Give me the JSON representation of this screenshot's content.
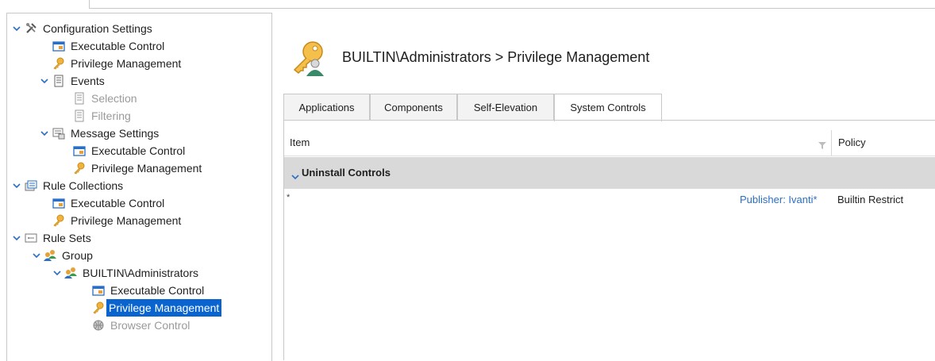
{
  "tree": {
    "items": [
      {
        "label": "Configuration Settings"
      },
      {
        "label": "Executable Control"
      },
      {
        "label": "Privilege Management"
      },
      {
        "label": "Events"
      },
      {
        "label": "Selection"
      },
      {
        "label": "Filtering"
      },
      {
        "label": "Message Settings"
      },
      {
        "label": "Executable Control"
      },
      {
        "label": "Privilege Management"
      },
      {
        "label": "Rule Collections"
      },
      {
        "label": "Executable Control"
      },
      {
        "label": "Privilege Management"
      },
      {
        "label": "Rule Sets"
      },
      {
        "label": "Group"
      },
      {
        "label": "BUILTIN\\Administrators"
      },
      {
        "label": "Executable Control"
      },
      {
        "label": "Privilege Management"
      },
      {
        "label": "Browser Control"
      }
    ]
  },
  "header": {
    "title": "BUILTIN\\Administrators > Privilege Management"
  },
  "tabs": [
    {
      "label": "Applications"
    },
    {
      "label": "Components"
    },
    {
      "label": "Self-Elevation"
    },
    {
      "label": "System Controls"
    }
  ],
  "grid": {
    "columns": {
      "item": "Item",
      "policy": "Policy"
    },
    "group": {
      "label": "Uninstall Controls"
    },
    "rows": [
      {
        "item": "*",
        "publisher": "Publisher: Ivanti*",
        "policy": "Builtin Restrict"
      }
    ]
  },
  "colors": {
    "selection": "#0a64d0",
    "link": "#2a6fc4",
    "group_bg": "#d9d9d9"
  }
}
